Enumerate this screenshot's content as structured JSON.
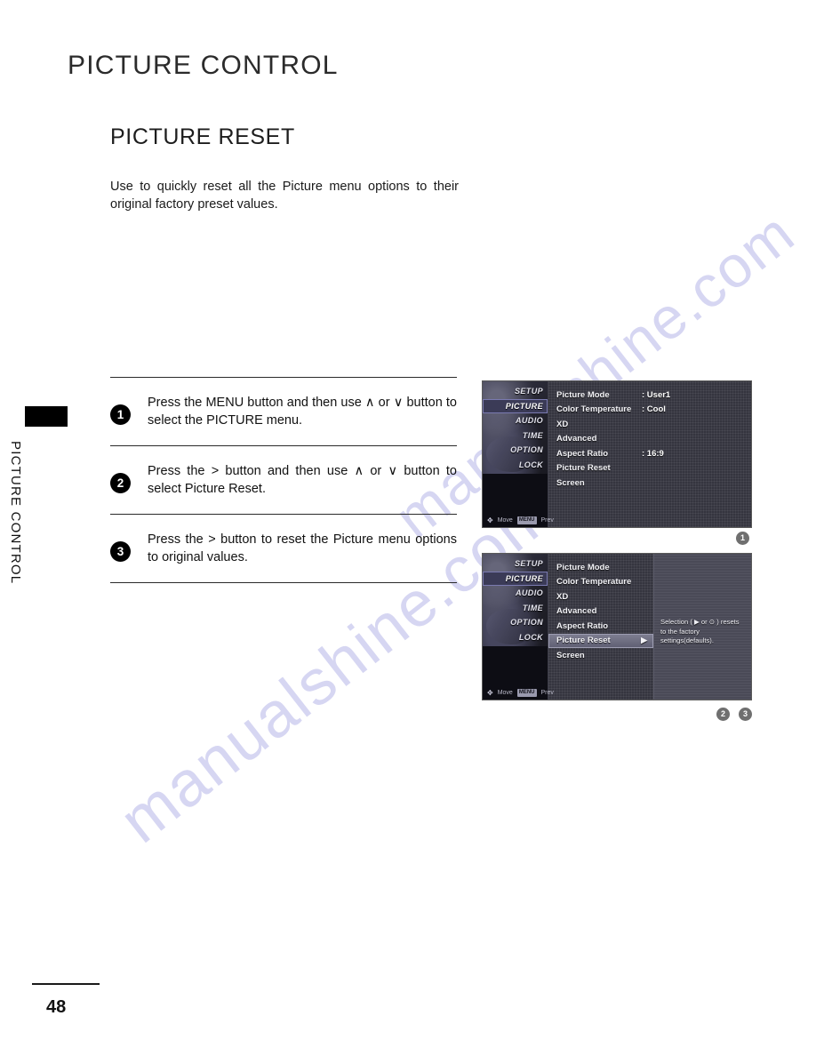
{
  "document": {
    "chapter_title": "PICTURE CONTROL",
    "section_title": "PICTURE RESET",
    "intro": "Use to quickly reset all the Picture menu options to their original factory preset values.",
    "side_tab_label": "PICTURE CONTROL",
    "page_number": "48"
  },
  "watermark": {
    "line1": "manualshine.com",
    "line2": "manualshine.com"
  },
  "steps": [
    {
      "number": "1",
      "parts": [
        {
          "text": "Press the ",
          "bold": false
        },
        {
          "text": "MENU",
          "bold": true
        },
        {
          "text": " button and then use ",
          "bold": false
        },
        {
          "text": "∧",
          "bold": false
        },
        {
          "text": " or ",
          "bold": false
        },
        {
          "text": "∨",
          "bold": false
        },
        {
          "text": " button to select the ",
          "bold": false
        },
        {
          "text": "PICTURE",
          "bold": true
        },
        {
          "text": " menu.",
          "bold": false
        }
      ],
      "plain": "Press the MENU button and then use ∧ or ∨ button to select the PICTURE menu."
    },
    {
      "number": "2",
      "plain": "Press the > button and then use ∧ or ∨ button to select Picture Reset."
    },
    {
      "number": "3",
      "plain": "Press the > button to reset the Picture menu options to original values."
    }
  ],
  "osd_nav": {
    "items": [
      {
        "label": "SETUP",
        "selected": false
      },
      {
        "label": "PICTURE",
        "selected": true
      },
      {
        "label": "AUDIO",
        "selected": false
      },
      {
        "label": "TIME",
        "selected": false
      },
      {
        "label": "OPTION",
        "selected": false
      },
      {
        "label": "LOCK",
        "selected": false
      }
    ],
    "footer": {
      "move_icon": "✥",
      "move_label": "Move",
      "prev_key": "MENU",
      "prev_label": "Prev"
    }
  },
  "osd_screen_1": {
    "rows": [
      {
        "label": "Picture Mode",
        "value": ": User1",
        "highlighted": false
      },
      {
        "label": "Color Temperature",
        "value": ": Cool",
        "highlighted": false
      },
      {
        "label": "XD",
        "value": "",
        "highlighted": false
      },
      {
        "label": "Advanced",
        "value": "",
        "highlighted": false
      },
      {
        "label": "Aspect Ratio",
        "value": ": 16:9",
        "highlighted": false
      },
      {
        "label": "Picture Reset",
        "value": "",
        "highlighted": false
      },
      {
        "label": "Screen",
        "value": "",
        "highlighted": false
      }
    ]
  },
  "osd_screen_2": {
    "rows": [
      {
        "label": "Picture Mode",
        "value": "",
        "highlighted": false
      },
      {
        "label": "Color Temperature",
        "value": "",
        "highlighted": false
      },
      {
        "label": "XD",
        "value": "",
        "highlighted": false
      },
      {
        "label": "Advanced",
        "value": "",
        "highlighted": false
      },
      {
        "label": "Aspect Ratio",
        "value": "",
        "highlighted": false
      },
      {
        "label": "Picture Reset",
        "value": "",
        "highlighted": true,
        "arrow": "▶"
      },
      {
        "label": "Screen",
        "value": "",
        "highlighted": false
      }
    ],
    "help_text": "Selection ( ▶ or ⊙ ) resets to the factory settings(defaults)."
  },
  "markers": {
    "after_screen_1": [
      "1"
    ],
    "after_screen_2": [
      "2",
      "3"
    ]
  },
  "colors": {
    "osd_background": "#35353f",
    "osd_nav_background": "#0d0d14",
    "osd_highlight": "#7f7f92",
    "osd_nav_selected": "#3b3b57",
    "watermark": "#d6d6f2",
    "ink": "#111111"
  }
}
